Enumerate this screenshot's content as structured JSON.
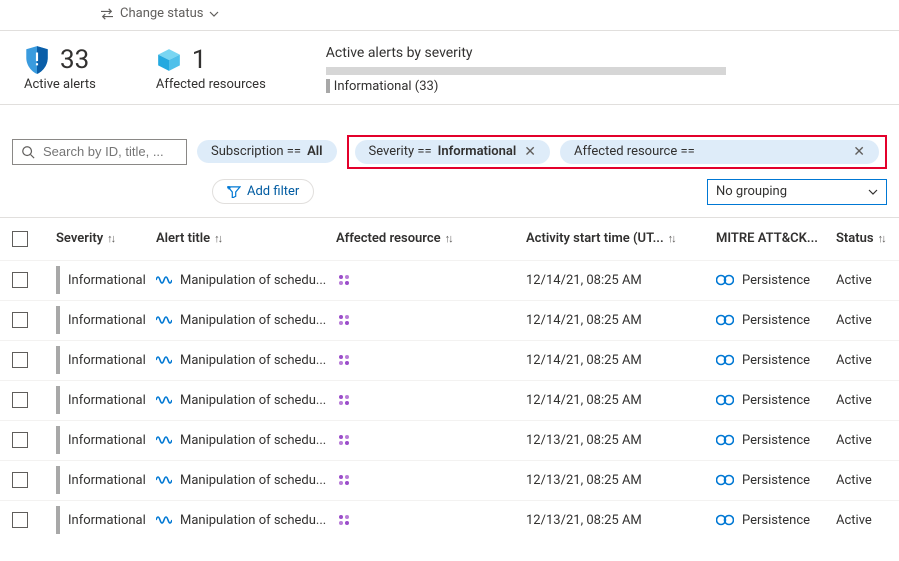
{
  "toolbar": {
    "change_status": "Change status"
  },
  "summary": {
    "active_alerts_count": "33",
    "active_alerts_label": "Active alerts",
    "affected_resources_count": "1",
    "affected_resources_label": "Affected resources",
    "severity_title": "Active alerts by severity",
    "severity_caption": "Informational (33)"
  },
  "filters": {
    "search_placeholder": "Search by ID, title, ...",
    "subscription_pill_prefix": "Subscription == ",
    "subscription_pill_value": "All",
    "severity_pill_prefix": "Severity == ",
    "severity_pill_value": "Informational",
    "affected_pill_label": "Affected resource ==",
    "add_filter": "Add filter",
    "grouping_value": "No grouping"
  },
  "columns": {
    "severity": "Severity",
    "title": "Alert title",
    "resource": "Affected resource",
    "time": "Activity start time (UT...",
    "mitre": "MITRE ATT&CK...",
    "status": "Status"
  },
  "rows": [
    {
      "severity": "Informational",
      "title": "Manipulation of schedu...",
      "time": "12/14/21, 08:25 AM",
      "mitre": "Persistence",
      "status": "Active"
    },
    {
      "severity": "Informational",
      "title": "Manipulation of schedu...",
      "time": "12/14/21, 08:25 AM",
      "mitre": "Persistence",
      "status": "Active"
    },
    {
      "severity": "Informational",
      "title": "Manipulation of schedu...",
      "time": "12/14/21, 08:25 AM",
      "mitre": "Persistence",
      "status": "Active"
    },
    {
      "severity": "Informational",
      "title": "Manipulation of schedu...",
      "time": "12/14/21, 08:25 AM",
      "mitre": "Persistence",
      "status": "Active"
    },
    {
      "severity": "Informational",
      "title": "Manipulation of schedu...",
      "time": "12/13/21, 08:25 AM",
      "mitre": "Persistence",
      "status": "Active"
    },
    {
      "severity": "Informational",
      "title": "Manipulation of schedu...",
      "time": "12/13/21, 08:25 AM",
      "mitre": "Persistence",
      "status": "Active"
    },
    {
      "severity": "Informational",
      "title": "Manipulation of schedu...",
      "time": "12/13/21, 08:25 AM",
      "mitre": "Persistence",
      "status": "Active"
    }
  ]
}
